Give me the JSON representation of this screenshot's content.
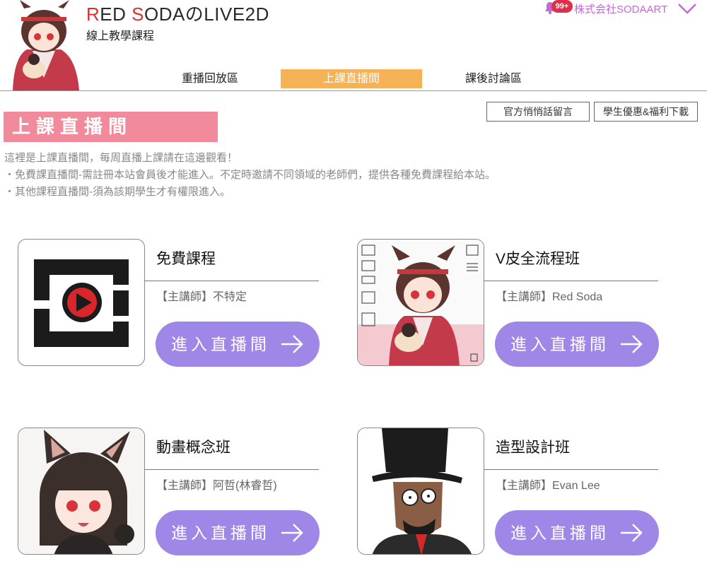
{
  "header": {
    "brand_title_initial_1": "R",
    "brand_title_part_1": "ED ",
    "brand_title_initial_2": "S",
    "brand_title_part_2": "ODAのLIVE2D",
    "brand_subtitle": "線上教學課程",
    "notification_count": "99+",
    "company_name": "株式会社SODAART",
    "accent_color": "#c06ad6"
  },
  "nav": {
    "tabs": [
      {
        "label": "重播回放區",
        "active": false
      },
      {
        "label": "上課直播間",
        "active": true
      },
      {
        "label": "課後討論區",
        "active": false
      }
    ]
  },
  "page": {
    "title": "上課直播間",
    "buttons": [
      "官方悄悄話留言",
      "學生優惠&福利下載"
    ],
    "intro_lines": [
      "這裡是上課直播間，每周直播上課請在這邊觀看！",
      "・免費課直播間-需註冊本站會員後才能進入。不定時邀請不同領域的老師們，提供各種免費課程給本站。",
      "・其他課程直播間-須為該期學生才有權限進入。"
    ]
  },
  "courses": [
    {
      "name": "免費課程",
      "instructor": "【主講師】不特定",
      "button": "進入直播間",
      "thumb": "logo-play-icon"
    },
    {
      "name": "V皮全流程班",
      "instructor": "【主講師】Red Soda",
      "button": "進入直播間",
      "thumb": "vtuber-editor-illustration"
    },
    {
      "name": "動畫概念班",
      "instructor": "【主講師】阿哲(林睿哲)",
      "button": "進入直播間",
      "thumb": "catgirl-illustration"
    },
    {
      "name": "造型設計班",
      "instructor": "【主講師】Evan Lee",
      "button": "進入直播間",
      "thumb": "tophat-man-illustration"
    }
  ],
  "colors": {
    "active_tab": "#f5b256",
    "page_title_bg": "#f18a9b",
    "enter_button": "#9f87e8",
    "badge": "#e02e4a"
  }
}
